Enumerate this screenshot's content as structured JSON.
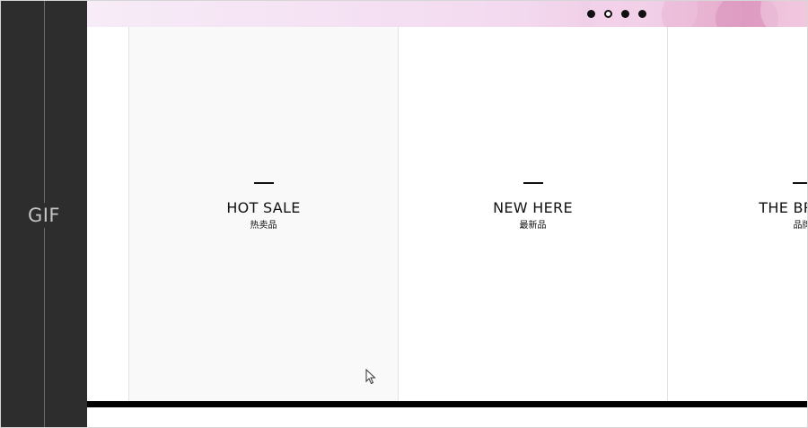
{
  "sidebar": {
    "label": "GIF"
  },
  "banner": {
    "carousel_dots": [
      {
        "state": "filled"
      },
      {
        "state": "active"
      },
      {
        "state": "filled"
      },
      {
        "state": "filled"
      }
    ]
  },
  "tiles": [
    {
      "title": "HOT SALE",
      "subtitle": "热卖品"
    },
    {
      "title": "NEW HERE",
      "subtitle": "最新品"
    },
    {
      "title": "THE BRAND",
      "subtitle": "品牌"
    }
  ],
  "icons": {
    "cursor": "mouse-pointer-icon"
  },
  "colors": {
    "sidebar_bg": "#2d2d2d",
    "banner_pink": "#e3a6c7",
    "text": "#111111",
    "bottom_bar": "#000000"
  }
}
